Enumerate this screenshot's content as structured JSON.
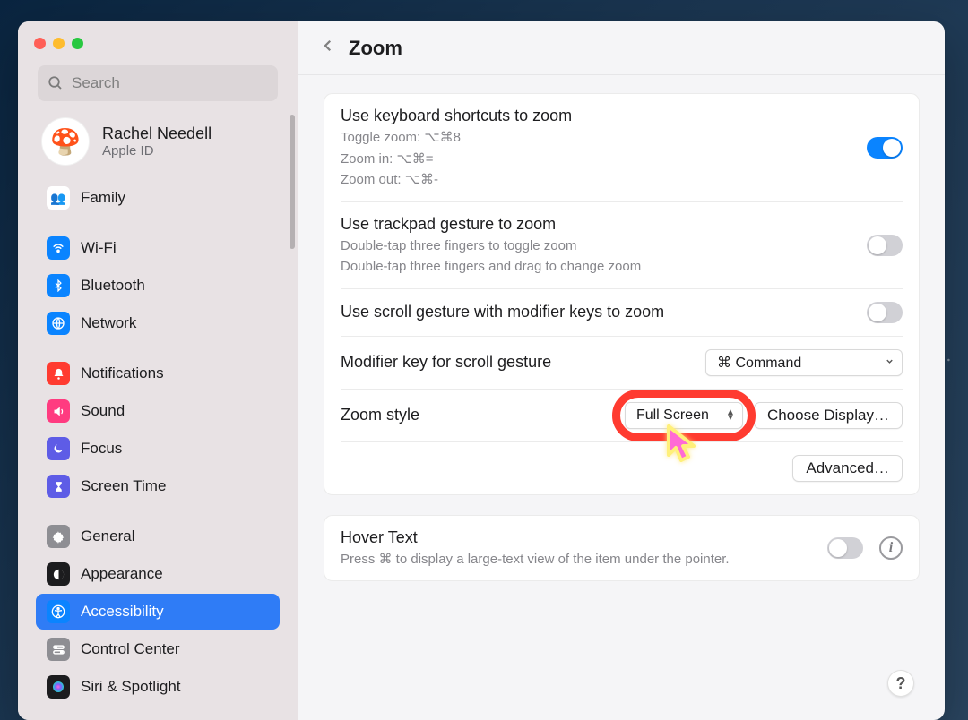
{
  "window": {
    "title": "Zoom"
  },
  "search": {
    "placeholder": "Search"
  },
  "account": {
    "name": "Rachel Needell",
    "sub": "Apple ID",
    "avatar_emoji": "🍄"
  },
  "sidebar": {
    "family": {
      "label": "Family",
      "icon_bg": "#ffffff",
      "emoji": "👥"
    },
    "items": [
      {
        "label": "Wi-Fi",
        "icon_bg": "#0a84ff",
        "glyph": "wifi"
      },
      {
        "label": "Bluetooth",
        "icon_bg": "#0a84ff",
        "glyph": "bluetooth"
      },
      {
        "label": "Network",
        "icon_bg": "#0a84ff",
        "glyph": "globe"
      },
      {
        "label": "Notifications",
        "icon_bg": "#ff3b30",
        "glyph": "bell"
      },
      {
        "label": "Sound",
        "icon_bg": "#ff3b80",
        "glyph": "speaker"
      },
      {
        "label": "Focus",
        "icon_bg": "#5e5ce6",
        "glyph": "moon"
      },
      {
        "label": "Screen Time",
        "icon_bg": "#5e5ce6",
        "glyph": "hourglass"
      },
      {
        "label": "General",
        "icon_bg": "#8e8e93",
        "glyph": "gear"
      },
      {
        "label": "Appearance",
        "icon_bg": "#1c1c1e",
        "glyph": "appearance"
      },
      {
        "label": "Accessibility",
        "icon_bg": "#0a84ff",
        "glyph": "accessibility",
        "selected": true
      },
      {
        "label": "Control Center",
        "icon_bg": "#8e8e93",
        "glyph": "switches"
      },
      {
        "label": "Siri & Spotlight",
        "icon_bg": "#1c1c1e",
        "glyph": "siri"
      }
    ]
  },
  "main": {
    "kb": {
      "title": "Use keyboard shortcuts to zoom",
      "desc1": "Toggle zoom: ⌥⌘8",
      "desc2": "Zoom in: ⌥⌘=",
      "desc3": "Zoom out: ⌥⌘-",
      "on": true
    },
    "trackpad": {
      "title": "Use trackpad gesture to zoom",
      "desc1": "Double-tap three fingers to toggle zoom",
      "desc2": "Double-tap three fingers and drag to change zoom",
      "on": false
    },
    "scroll": {
      "title": "Use scroll gesture with modifier keys to zoom",
      "on": false
    },
    "modifier": {
      "title": "Modifier key for scroll gesture",
      "value": "⌘ Command"
    },
    "style": {
      "title": "Zoom style",
      "value": "Full Screen",
      "choose_display": "Choose Display…"
    },
    "advanced": {
      "label": "Advanced…"
    },
    "hover": {
      "title": "Hover Text",
      "desc": "Press ⌘ to display a large-text view of the item under the pointer.",
      "on": false
    }
  }
}
